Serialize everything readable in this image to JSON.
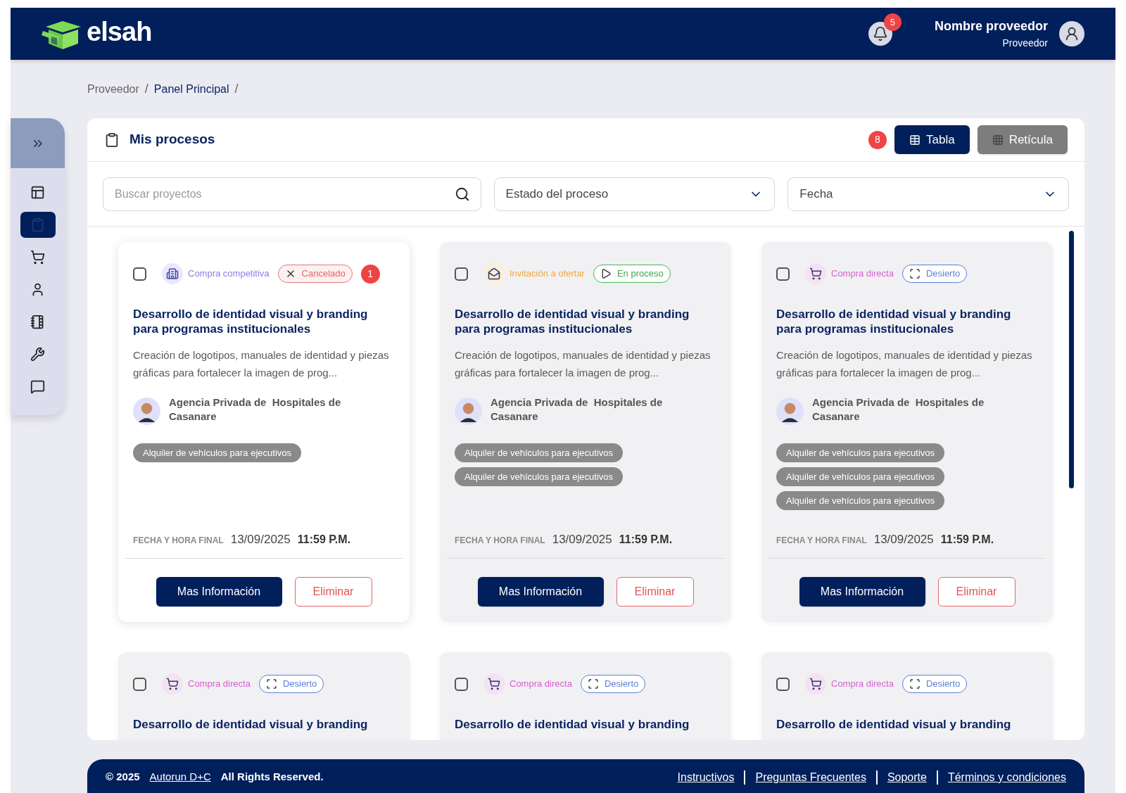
{
  "header": {
    "logo_text": "elsah",
    "notifications": "5",
    "user_name": "Nombre proveedor",
    "user_role": "Proveedor"
  },
  "sidebar": {
    "items": [
      {
        "kind": "layout",
        "selected": false
      },
      {
        "kind": "clipboard",
        "selected": true
      },
      {
        "kind": "cart",
        "selected": false
      },
      {
        "kind": "user",
        "selected": false
      },
      {
        "kind": "notebook",
        "selected": false
      },
      {
        "kind": "support",
        "selected": false
      },
      {
        "kind": "help",
        "selected": false
      }
    ]
  },
  "breadcrumb": [
    {
      "label": "Proveedor",
      "current": false,
      "separator": "/"
    },
    {
      "label": "Panel Principal",
      "current": true,
      "separator": "/"
    }
  ],
  "panel": {
    "title": "Mis procesos",
    "count": "8",
    "views": [
      {
        "label": "Tabla",
        "kind": "table",
        "selected": true
      },
      {
        "label": "Retícula",
        "kind": "grid",
        "selected": false
      }
    ],
    "search": {
      "placeholder": "Buscar proyectos"
    },
    "filters": [
      {
        "label": "Estado del proceso"
      },
      {
        "label": "Fecha"
      }
    ],
    "cards": [
      {
        "selected": true,
        "checked": false,
        "category": {
          "kind": "competitive",
          "label": "Compra competitiva"
        },
        "status": {
          "kind": "cancelled",
          "label": "Cancelado"
        },
        "badge": "1",
        "title": "Desarrollo de identidad visual y branding para programas institucionales",
        "description": "Creación de logotipos, manuales de identidad y piezas gráficas para fortalecer la imagen de prog...",
        "org": "Agencia Privada de  Hospitales de Casanare",
        "tags": [
          "Alquiler de vehículos para ejecutivos"
        ],
        "date_label": "FECHA Y HORA FINAL",
        "date": "13/09/2025",
        "time": "11:59 P.M.",
        "actions": [
          "Mas Información",
          "Eliminar"
        ]
      },
      {
        "selected": false,
        "checked": false,
        "category": {
          "kind": "invitation",
          "label": "Invitación a ofertar"
        },
        "status": {
          "kind": "in_progress",
          "label": "En proceso"
        },
        "title": "Desarrollo de identidad visual y branding para programas institucionales",
        "description": "Creación de logotipos, manuales de identidad y piezas gráficas para fortalecer la imagen de prog...",
        "org": "Agencia Privada de  Hospitales de Casanare",
        "tags": [
          "Alquiler de vehículos para ejecutivos",
          "Alquiler de vehículos para ejecutivos"
        ],
        "date_label": "FECHA Y HORA FINAL",
        "date": "13/09/2025",
        "time": "11:59 P.M.",
        "actions": [
          "Mas Información",
          "Eliminar"
        ]
      },
      {
        "selected": false,
        "checked": false,
        "category": {
          "kind": "direct",
          "label": "Compra directa"
        },
        "status": {
          "kind": "deserted",
          "label": "Desierto"
        },
        "title": "Desarrollo de identidad visual y branding para programas institucionales",
        "description": "Creación de logotipos, manuales de identidad y piezas gráficas para fortalecer la imagen de prog...",
        "org": "Agencia Privada de  Hospitales de Casanare",
        "tags": [
          "Alquiler de vehículos para ejecutivos",
          "Alquiler de vehículos para ejecutivos",
          "Alquiler de vehículos para ejecutivos"
        ],
        "date_label": "FECHA Y HORA FINAL",
        "date": "13/09/2025",
        "time": "11:59 P.M.",
        "actions": [
          "Mas Información",
          "Eliminar"
        ]
      },
      {
        "selected": false,
        "checked": false,
        "category": {
          "kind": "direct",
          "label": "Compra directa"
        },
        "status": {
          "kind": "deserted",
          "label": "Desierto"
        },
        "title": "Desarrollo de identidad visual y branding"
      },
      {
        "selected": false,
        "checked": false,
        "category": {
          "kind": "direct",
          "label": "Compra directa"
        },
        "status": {
          "kind": "deserted",
          "label": "Desierto"
        },
        "title": "Desarrollo de identidad visual y branding"
      },
      {
        "selected": false,
        "checked": false,
        "category": {
          "kind": "direct",
          "label": "Compra directa"
        },
        "status": {
          "kind": "deserted",
          "label": "Desierto"
        },
        "title": "Desarrollo de identidad visual y branding"
      }
    ]
  },
  "footer": {
    "copyright": "© 2025",
    "company": "Autorun D+C",
    "rights": "All Rights Reserved.",
    "links": [
      "Instructivos",
      "Preguntas Frecuentes",
      "Soporte",
      "Términos y condiciones"
    ]
  }
}
